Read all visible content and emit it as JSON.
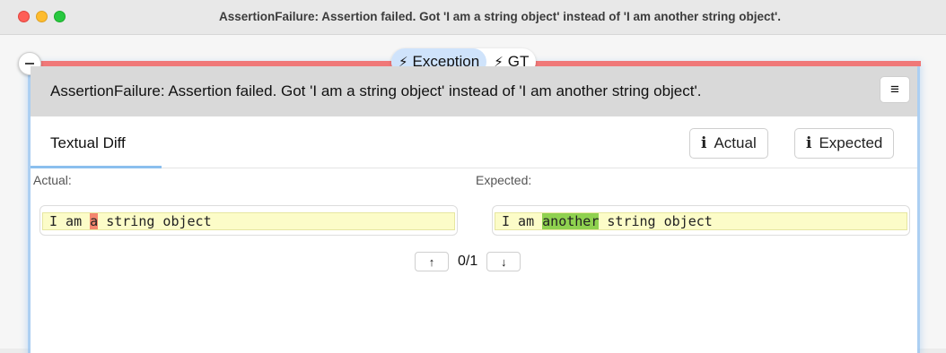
{
  "window": {
    "title": "AssertionFailure: Assertion failed. Got 'I am a string object' instead of 'I am another string object'."
  },
  "tabs": [
    {
      "label": "Exception",
      "icon": "lightning-icon",
      "active": true
    },
    {
      "label": "GT",
      "icon": "lightning-icon",
      "active": false
    }
  ],
  "header": {
    "message": "AssertionFailure: Assertion failed. Got 'I am a string object' instead of 'I am another string object'.",
    "menu_icon": "≡"
  },
  "view": {
    "tab_label": "Textual Diff",
    "actual_button": "Actual",
    "expected_button": "Expected",
    "info_icon": "i"
  },
  "diff": {
    "actual_label": "Actual:",
    "expected_label": "Expected:",
    "actual": {
      "before": "I am ",
      "changed": "a",
      "after": " string object"
    },
    "expected": {
      "before": "I am ",
      "changed": "another",
      "after": " string object"
    },
    "deletion_color": "#f4866e",
    "insertion_color": "#8fd14f"
  },
  "navigation": {
    "up_icon": "↑",
    "down_icon": "↓",
    "counter": "0/1"
  }
}
